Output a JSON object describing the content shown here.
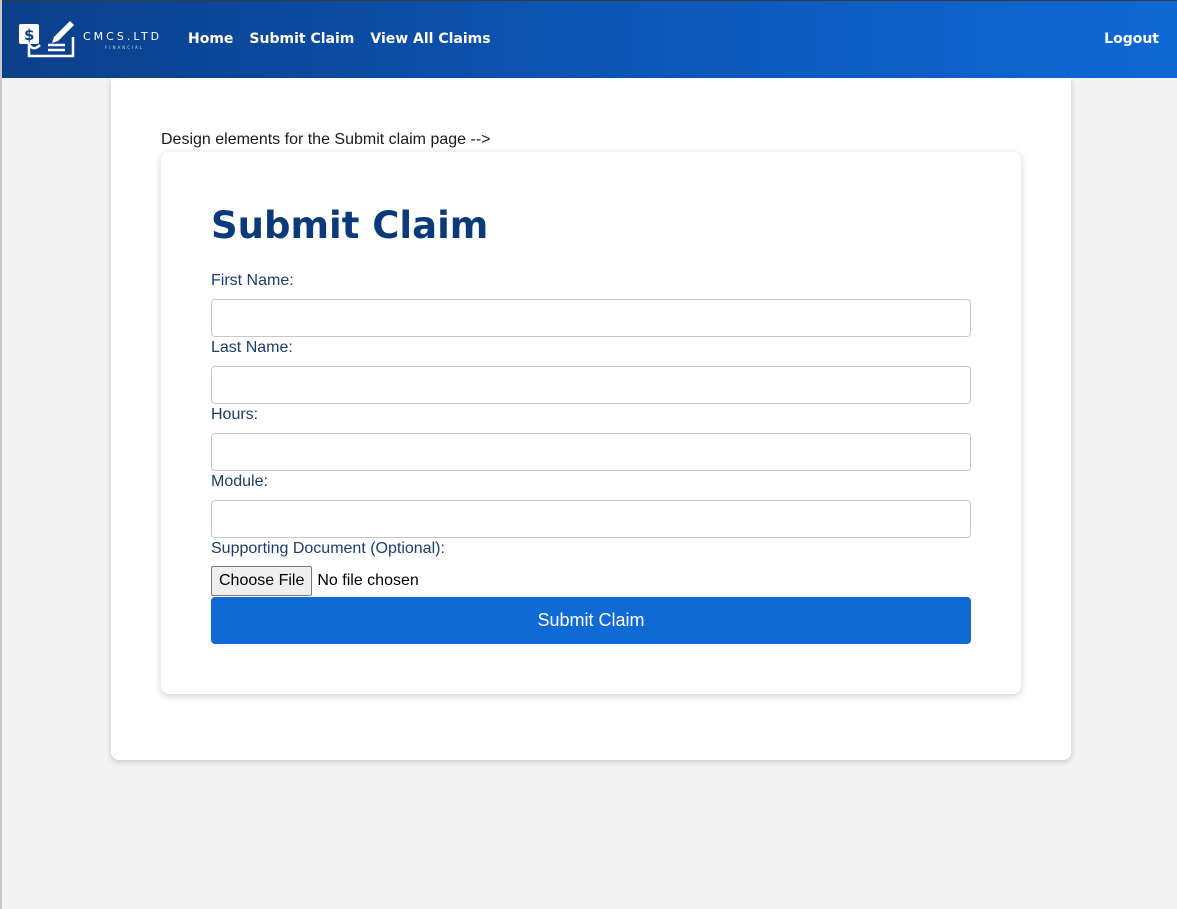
{
  "navbar": {
    "logo_text": "CMCS.LTD",
    "logo_subtext": "FINANCIAL",
    "links": [
      "Home",
      "Submit Claim",
      "View All Claims"
    ],
    "logout_label": "Logout"
  },
  "page": {
    "design_comment": "Design elements for the Submit claim page -->"
  },
  "form": {
    "title": "Submit Claim",
    "fields": [
      {
        "label": "First Name:",
        "value": ""
      },
      {
        "label": "Last Name:",
        "value": ""
      },
      {
        "label": "Hours:",
        "value": ""
      },
      {
        "label": "Module:",
        "value": ""
      }
    ],
    "document_label": "Supporting Document (Optional):",
    "file_button_label": "Choose File",
    "file_status": "No file chosen",
    "submit_label": "Submit Claim"
  },
  "colors": {
    "nav_start": "#0b3f8a",
    "nav_end": "#0e68d4",
    "accent": "#0f6ad6",
    "title": "#0b3a7a",
    "label": "#1b3d6e"
  },
  "icons": {
    "logo": "dollar-document-pen-icon"
  }
}
